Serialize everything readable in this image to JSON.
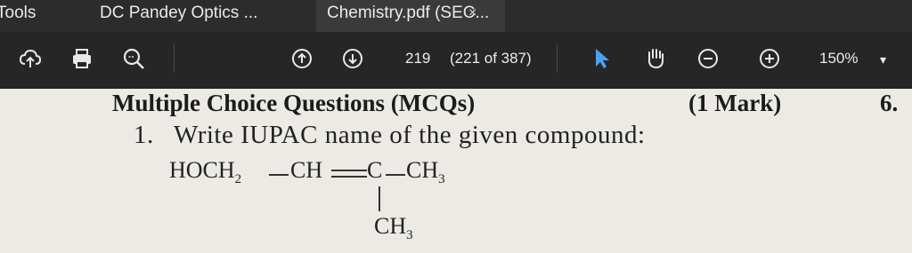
{
  "tabs": {
    "tools": "Tools",
    "tab1": "DC Pandey Optics ...",
    "tab2": "Chemistry.pdf (SEC...",
    "close": "×"
  },
  "toolbar": {
    "page_current": "219",
    "page_info": "(221 of 387)",
    "zoom": "150%",
    "zoom_dropdown": "▾"
  },
  "document": {
    "heading": "Multiple Choice Questions (MCQs)",
    "marks": "(1 Mark)",
    "side_number": "6.",
    "question_number": "1.",
    "question_text": "Write IUPAC name of the given compound:",
    "formula": {
      "hoch": "HOCH",
      "sub2": "2",
      "ch": "CH",
      "c": "C",
      "ch3_right": "CH",
      "sub3_right": "3",
      "ch3_bottom": "CH",
      "sub3_bottom": "3"
    }
  }
}
